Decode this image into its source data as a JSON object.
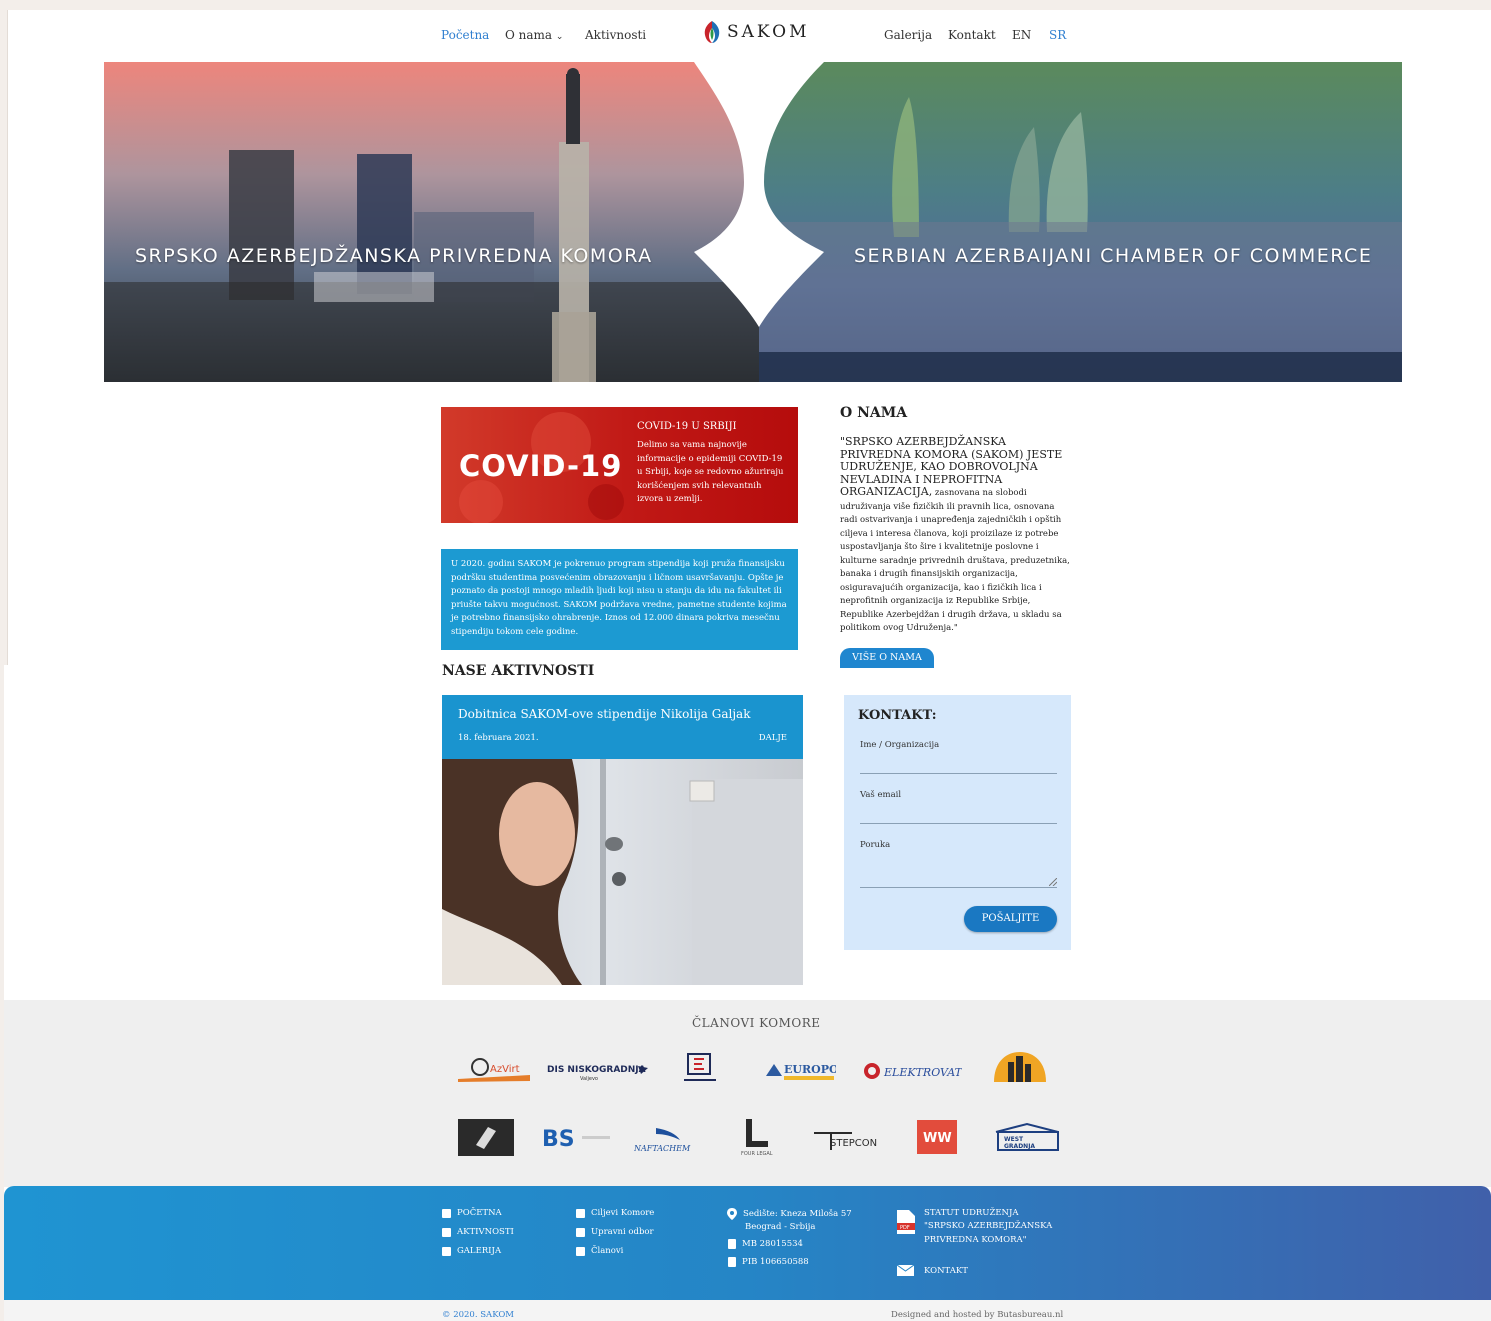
{
  "nav": {
    "home": "Početna",
    "about": "O nama",
    "activities": "Aktivnosti",
    "logo": "SAKOM",
    "gallery": "Galerija",
    "contact": "Kontakt",
    "lang_en": "EN",
    "lang_sr": "SR"
  },
  "hero": {
    "left_caption": "SRPSKO AZERBEJDŽANSKA PRIVREDNA KOMORA",
    "right_caption": "SERBIAN AZERBAIJANI CHAMBER OF COMMERCE"
  },
  "covid": {
    "big": "COVID-19",
    "title": "COVID-19 U SRBIJI",
    "text": "Delimo sa vama najnovije informacije o epidemiji COVID-19 u Srbiji, koje se redovno ažuriraju korišćenjem svih relevantnih izvora u zemlji."
  },
  "scholarship": {
    "text": "U 2020. godini SAKOM je pokrenuo program stipendija koji pruža finansijsku podršku studentima posvećenim obrazovanju i ličnom usavršavanju. Opšte je poznato da postoji mnogo mladih ljudi koji nisu u stanju da idu na fakultet ili priušte takvu mogućnost. SAKOM podržava vredne, pametne studente kojima je potrebno finansijsko ohrabrenje. Iznos od 12.000 dinara pokriva mesečnu stipendiju tokom cele godine."
  },
  "about": {
    "heading": "O NAMA",
    "caps": "\"SRPSKO AZERBEJDŽANSKA PRIVREDNA KOMORA (SAKOM) JESTE UDRUŽENJE, KAO DOBROVOLJNA NEVLADINA I NEPROFITNA ORGANIZACIJA,",
    "body": " zasnovana na slobodi udruživanja više fizičkih ili pravnih lica, osnovana radi ostvarivanja i unapređenja zajedničkih i opštih ciljeva i interesa članova, koji proizilaze iz potrebe uspostavljanja što šire i kvalitetnije poslovne i kulturne saradnje privrednih društava, preduzetnika, banaka i drugih finansijskih organizacija, osiguravajućih organizacija, kao i fizičkih lica i neprofitnih organizacija iz Republike Srbije, Republike Azerbejdžan i drugih država, u skladu sa politikom ovog Udruženja.\"",
    "button": "VIŠE O NAMA"
  },
  "activities": {
    "heading": "NASE AKTIVNOSTI",
    "card_title": "Dobitnica SAKOM-ove stipendije Nikolija Galjak",
    "card_date": "18. februara 2021.",
    "card_more": "DALJE"
  },
  "contact_form": {
    "heading": "KONTAKT:",
    "name_label": "Ime / Organizacija",
    "email_label": "Vaš email",
    "message_label": "Poruka",
    "submit": "POŠALJITE"
  },
  "members": {
    "heading": "ČLANOVI KOMORE",
    "logos": [
      "AzVirt",
      "DIS NISKOGRADNJA",
      "Elektrovat E",
      "EUROPOLIS",
      "ELEKTROVAT",
      "Building",
      "Dark",
      "BS",
      "NAFTACHEM",
      "FOUR LEGAL",
      "STEPCON",
      "WW",
      "WEST GRADNJA"
    ],
    "dis_sub": "Valjevo",
    "four_sub": "FOUR LEGAL"
  },
  "footer": {
    "links_col1": [
      "POČETNA",
      "AKTIVNOSTI",
      "GALERIJA"
    ],
    "links_col2": [
      "Ciljevi Komore",
      "Upravni odbor",
      "Članovi"
    ],
    "address_line1": "Sedište: Kneza Miloša 57",
    "address_line2": "Beograd - Srbija",
    "mb": "MB 28015534",
    "pib": "PIB 106650588",
    "statut_line1": "STATUT UDRUŽENJA",
    "statut_line2": "\"SRPSKO AZERBEJDŽANSKA",
    "statut_line3": "PRIVREDNA KOMORA\"",
    "contact": "KONTAKT",
    "copyright": "© 2020. SAKOM",
    "credits": "Designed and hosted by Butasbureau.nl"
  },
  "colors": {
    "accent_blue": "#1c9ad2",
    "link_blue": "#2f7fd0",
    "covid_red": "#c01815",
    "form_bg": "#d6e8fb"
  }
}
